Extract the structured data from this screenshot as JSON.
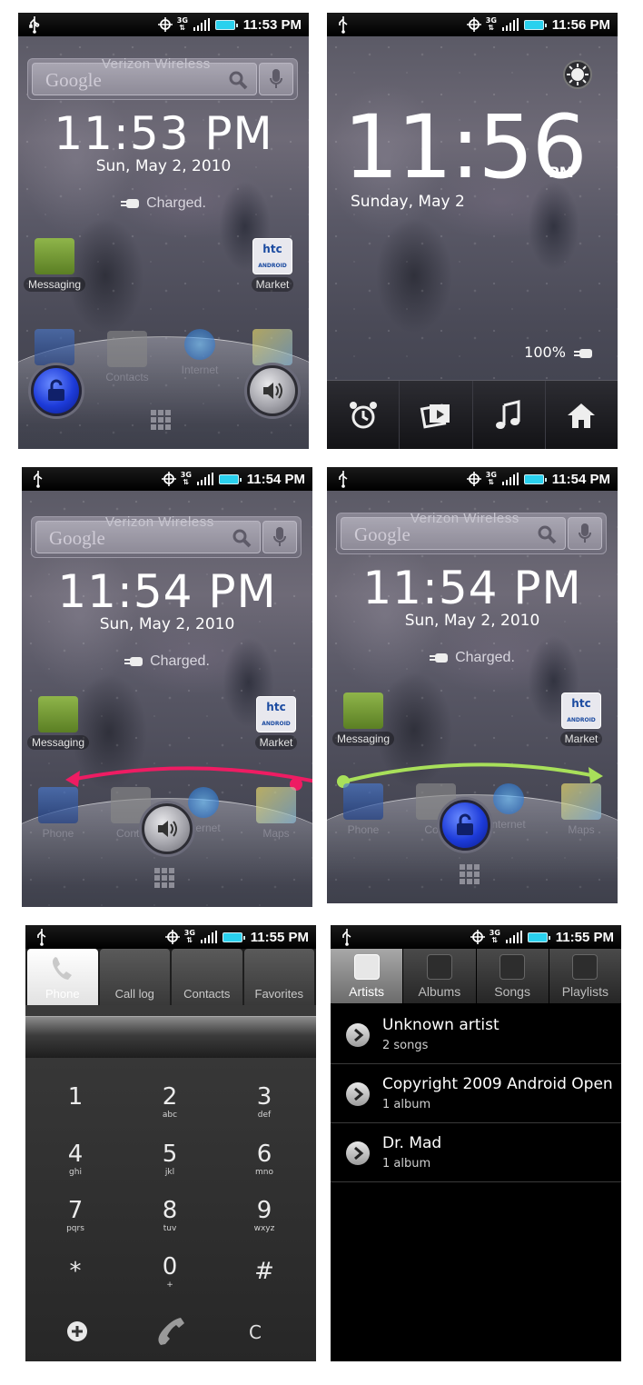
{
  "panels": {
    "lock1": {
      "status_time": "11:53 PM",
      "carrier": "Verizon Wireless",
      "google_logo": "Google",
      "clock": "11:53 PM",
      "date": "Sun, May 2, 2010",
      "charging": "Charged.",
      "apps": {
        "messaging": "Messaging",
        "market": "Market",
        "contacts": "Contacts",
        "internet": "Internet"
      },
      "market_logo_top": "htc",
      "market_logo_bottom": "ANDROID"
    },
    "lock2": {
      "status_time": "11:56 PM",
      "clock_hm": "11:56",
      "clock_ampm": "PM",
      "date": "Sunday, May 2",
      "battery": "100%"
    },
    "lock3": {
      "status_time": "11:54 PM",
      "carrier": "Verizon Wireless",
      "google_logo": "Google",
      "clock": "11:54 PM",
      "date": "Sun, May 2, 2010",
      "charging": "Charged.",
      "apps": {
        "messaging": "Messaging",
        "market": "Market",
        "phone": "Phone",
        "contacts": "Conta",
        "internet": "nternet",
        "maps": "Maps"
      },
      "market_logo_top": "htc",
      "market_logo_bottom": "ANDROID",
      "swipe_color": "#ee1c63"
    },
    "lock4": {
      "status_time": "11:54 PM",
      "carrier": "Verizon Wireless",
      "google_logo": "Google",
      "clock": "11:54 PM",
      "date": "Sun, May 2, 2010",
      "charging": "Charged.",
      "apps": {
        "messaging": "Messaging",
        "market": "Market",
        "phone": "Phone",
        "contacts": "Cont",
        "internet": "nternet",
        "maps": "Maps"
      },
      "market_logo_top": "htc",
      "market_logo_bottom": "ANDROID",
      "swipe_color": "#a8e05a"
    },
    "dialer": {
      "status_time": "11:55 PM",
      "tabs": [
        "Phone",
        "Call log",
        "Contacts",
        "Favorites"
      ],
      "keys": [
        {
          "d": "1",
          "l": ""
        },
        {
          "d": "2",
          "l": "abc"
        },
        {
          "d": "3",
          "l": "def"
        },
        {
          "d": "4",
          "l": "ghi"
        },
        {
          "d": "5",
          "l": "jkl"
        },
        {
          "d": "6",
          "l": "mno"
        },
        {
          "d": "7",
          "l": "pqrs"
        },
        {
          "d": "8",
          "l": "tuv"
        },
        {
          "d": "9",
          "l": "wxyz"
        },
        {
          "d": "*",
          "l": ""
        },
        {
          "d": "0",
          "l": "+"
        },
        {
          "d": "#",
          "l": ""
        }
      ],
      "clear_key": "C"
    },
    "music": {
      "status_time": "11:55 PM",
      "tabs": [
        "Artists",
        "Albums",
        "Songs",
        "Playlists"
      ],
      "rows": [
        {
          "title": "Unknown artist",
          "sub": "2 songs"
        },
        {
          "title": "Copyright 2009 Android Open",
          "sub": "1 album"
        },
        {
          "title": "Dr. Mad",
          "sub": "1 album"
        }
      ]
    }
  }
}
